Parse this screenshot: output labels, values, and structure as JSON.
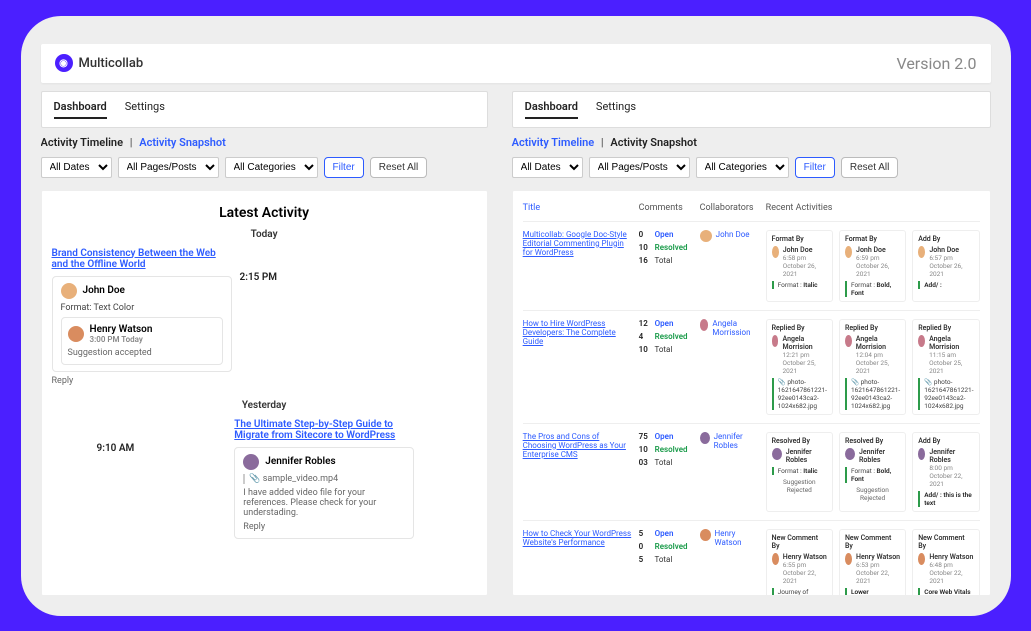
{
  "brand": "Multicollab",
  "version": "Version 2.0",
  "tabs": {
    "dashboard": "Dashboard",
    "settings": "Settings"
  },
  "subnav": {
    "timeline": "Activity Timeline",
    "snapshot": "Activity Snapshot",
    "sep": "|"
  },
  "filters": {
    "dates": "All Dates",
    "pages": "All Pages/Posts",
    "categories": "All Categories",
    "filter": "Filter",
    "reset": "Reset All"
  },
  "left": {
    "title": "Latest Activity",
    "today": "Today",
    "yesterday": "Yesterday",
    "entry1": {
      "post": "Brand Consistency Between the Web and the Offline World",
      "time": "2:15 PM",
      "user": "John Doe",
      "format": "Format: Text Color",
      "nested_user": "Henry Watson",
      "nested_ts": "3:00 PM Today",
      "nested_msg": "Suggestion accepted",
      "reply": "Reply"
    },
    "entry2": {
      "post": "The Ultimate Step-by-Step Guide to Migrate from Sitecore to WordPress",
      "time": "9:10 AM",
      "user": "Jennifer Robles",
      "file": "sample_video.mp4",
      "msg": "I have added video file for your references. Please check for your understading.",
      "reply": "Reply"
    }
  },
  "right": {
    "headers": {
      "title": "Title",
      "comments": "Comments",
      "collab": "Collaborators",
      "recent": "Recent Activities"
    },
    "rows": [
      {
        "title": "Multicollab: Google Doc-Style Editorial Commenting Plugin for WordPress",
        "comments": {
          "open": "0",
          "resolved": "10",
          "total": "16"
        },
        "open_lbl": "Open",
        "resolved_lbl": "Resolved",
        "total_lbl": "Total",
        "collab": "John Doe",
        "acts": [
          {
            "label": "Format By",
            "user": "John Doe",
            "ts": "6:58 pm October 26, 2021",
            "detail_pre": "Format : ",
            "detail_b": "Italic"
          },
          {
            "label": "Format By",
            "user": "Jonh Doe",
            "ts": "6:59 pm October 26, 2021",
            "detail_pre": "Format : ",
            "detail_b": "Bold, Font"
          },
          {
            "label": "Add By",
            "user": "John Doe",
            "ts": "6:57 pm October 26, 2021",
            "detail_pre": "",
            "detail_b": "Add/ :"
          }
        ]
      },
      {
        "title": "How to Hire WordPress Developers: The Complete Guide",
        "comments": {
          "open": "12",
          "resolved": "4",
          "total": "10"
        },
        "open_lbl": "Open",
        "resolved_lbl": "Resolved",
        "total_lbl": "Total",
        "collab": "Angela Morrission",
        "acts": [
          {
            "label": "Replied By",
            "user": "Angela Morrision",
            "ts": "12:21 pm October 25, 2021",
            "detail_pre": "📎 photo-1621647861221-92ee0143ca2-1024x682.jpg",
            "detail_b": ""
          },
          {
            "label": "Replied By",
            "user": "Angela Morrision",
            "ts": "12:04 pm October 25, 2021",
            "detail_pre": "📎 photo-1621647861221-92ee0143ca2-1024x682.jpg",
            "detail_b": ""
          },
          {
            "label": "Replied By",
            "user": "Angela Morrision",
            "ts": "11:15 am October 25, 2021",
            "detail_pre": "📎 photo-1621647861221-92ee0143ca2-1024x682.jpg",
            "detail_b": ""
          }
        ]
      },
      {
        "title": "The Pros and Cons of Choosing WordPress as Your Enterprise CMS",
        "comments": {
          "open": "75",
          "resolved": "10",
          "total": "03"
        },
        "open_lbl": "Open",
        "resolved_lbl": "Resolved",
        "total_lbl": "Total",
        "collab": "Jennifer Robles",
        "acts": [
          {
            "label": "Resolved By",
            "user": "Jennifer Robles",
            "ts": "",
            "detail_pre": "Format : ",
            "detail_b": "Italic",
            "extra": "Suggestion Rejected"
          },
          {
            "label": "Resolved By",
            "user": "Jennifer Robles",
            "ts": "",
            "detail_pre": "Format : ",
            "detail_b": "Bold, Font",
            "extra": "Suggestion Rejected"
          },
          {
            "label": "Add By",
            "user": "Jennifer Robles",
            "ts": "8:00 pm October 22, 2021",
            "detail_pre": "",
            "detail_b": "Add/ : this is the text"
          }
        ]
      },
      {
        "title": "How to Check Your WordPress Website's Performance",
        "comments": {
          "open": "5",
          "resolved": "0",
          "total": "5"
        },
        "open_lbl": "Open",
        "resolved_lbl": "Resolved",
        "total_lbl": "Total",
        "collab": "Henry Watson",
        "acts": [
          {
            "label": "New Comment By",
            "user": "Henry Watson",
            "ts": "6:55 pm October 22, 2021",
            "detail_pre": "Journey of running a successful",
            "detail_b": ""
          },
          {
            "label": "New Comment By",
            "user": "Henry Watson",
            "ts": "6:53 pm October 22, 2021",
            "detail_pre": "",
            "detail_b": "Lower Conversion Rate"
          },
          {
            "label": "New Comment By",
            "user": "Henry Watson",
            "ts": "6:48 pm October 22, 2021",
            "detail_pre": "",
            "detail_b": "Core Web Vitals"
          }
        ]
      }
    ]
  },
  "avatar_colors": {
    "john": "#e8b07a",
    "henry": "#d98c5f",
    "angela": "#c77a8a",
    "jennifer": "#8a6b9c"
  }
}
